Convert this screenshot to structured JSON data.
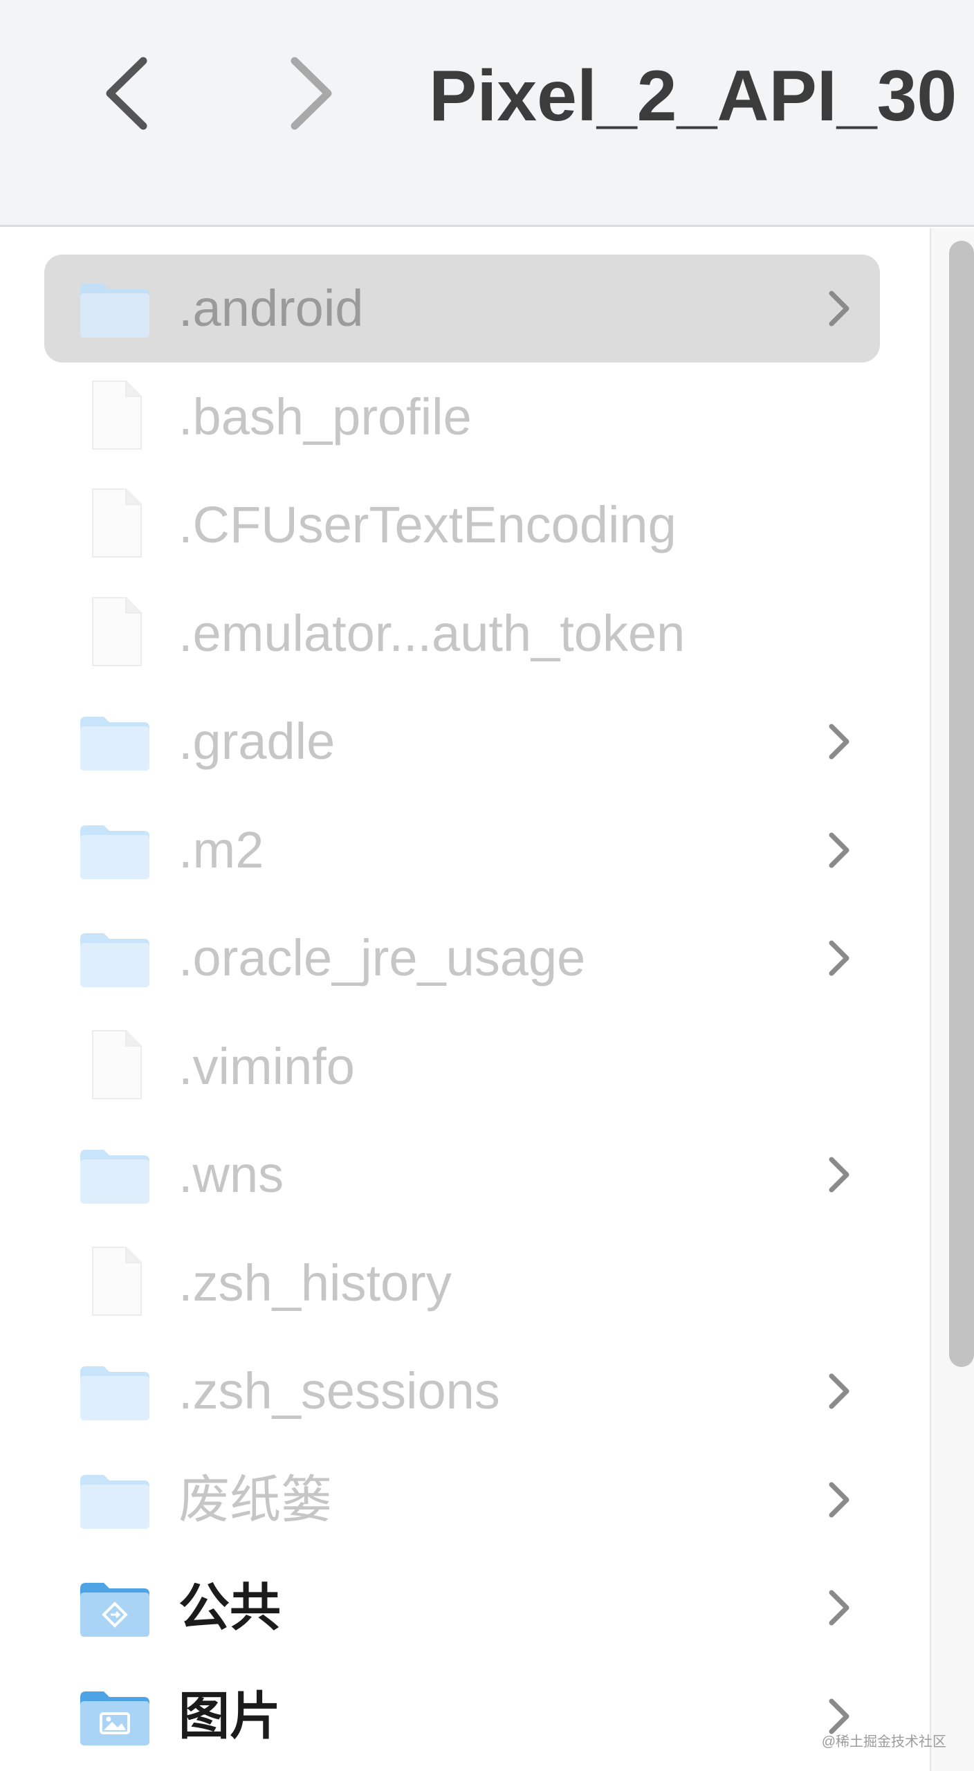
{
  "toolbar": {
    "back_icon": "chevron-left-icon",
    "forward_icon": "chevron-right-icon",
    "title": "Pixel_2_API_30"
  },
  "files": [
    {
      "name": ".android",
      "kind": "folder",
      "has_children": true,
      "selected": true,
      "dimmed": true
    },
    {
      "name": ".bash_profile",
      "kind": "document",
      "has_children": false,
      "selected": false,
      "dimmed": true
    },
    {
      "name": ".CFUserTextEncoding",
      "kind": "document",
      "has_children": false,
      "selected": false,
      "dimmed": true
    },
    {
      "name": ".emulator...auth_token",
      "kind": "document",
      "has_children": false,
      "selected": false,
      "dimmed": true
    },
    {
      "name": ".gradle",
      "kind": "folder",
      "has_children": true,
      "selected": false,
      "dimmed": true
    },
    {
      "name": ".m2",
      "kind": "folder",
      "has_children": true,
      "selected": false,
      "dimmed": true
    },
    {
      "name": ".oracle_jre_usage",
      "kind": "folder",
      "has_children": true,
      "selected": false,
      "dimmed": true
    },
    {
      "name": ".viminfo",
      "kind": "document",
      "has_children": false,
      "selected": false,
      "dimmed": true
    },
    {
      "name": ".wns",
      "kind": "folder",
      "has_children": true,
      "selected": false,
      "dimmed": true
    },
    {
      "name": ".zsh_history",
      "kind": "document",
      "has_children": false,
      "selected": false,
      "dimmed": true
    },
    {
      "name": ".zsh_sessions",
      "kind": "folder",
      "has_children": true,
      "selected": false,
      "dimmed": true
    },
    {
      "name": "废纸篓",
      "kind": "folder",
      "has_children": true,
      "selected": false,
      "dimmed": true
    },
    {
      "name": "公共",
      "kind": "public-folder",
      "has_children": true,
      "selected": false,
      "dimmed": false
    },
    {
      "name": "图片",
      "kind": "pictures-folder",
      "has_children": true,
      "selected": false,
      "dimmed": false
    }
  ],
  "watermark": "@稀土掘金技术社区",
  "colors": {
    "folder_light": "#cfe6fb",
    "folder_dark": "#5aaee8",
    "selected_row": "#dcdcdc",
    "dimmed_text": "#c6c6c6",
    "toolbar_bg": "#f3f4f5"
  }
}
